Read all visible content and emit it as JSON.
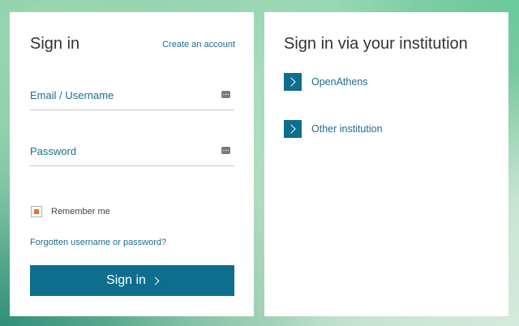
{
  "signin": {
    "title": "Sign in",
    "create_account": "Create an account",
    "email_placeholder": "Email / Username",
    "password_placeholder": "Password",
    "remember_label": "Remember me",
    "remember_checked": true,
    "forgot_link": "Forgotten username or password?",
    "button_label": "Sign in"
  },
  "institution": {
    "title": "Sign in via your institution",
    "items": [
      {
        "label": "OpenAthens"
      },
      {
        "label": "Other institution"
      }
    ]
  },
  "colors": {
    "accent": "#0f6d8e",
    "link": "#1a6f8c",
    "checkbox_fill": "#e0782a"
  },
  "icons": {
    "field_icon": "password-manager-key-icon",
    "button_icon": "chevron-right-icon",
    "institution_icon": "chevron-right-icon"
  }
}
